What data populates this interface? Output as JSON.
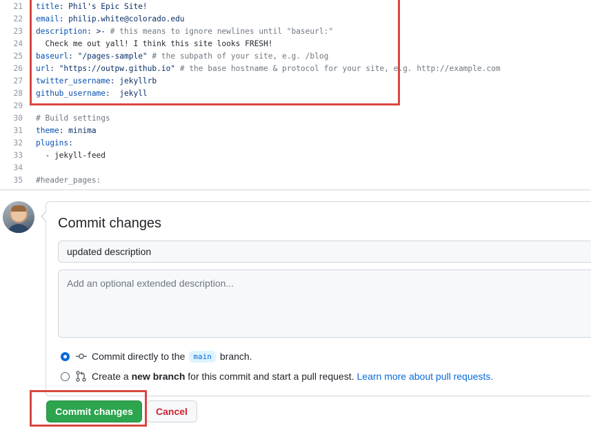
{
  "code_lines": [
    {
      "num": "21",
      "key": "title",
      "rest": ": Phil's Epic Site!"
    },
    {
      "num": "22",
      "key": "email",
      "rest": ": philip.white@colorado.edu"
    },
    {
      "num": "23",
      "key": "description",
      "rest": ": >- ",
      "comment": "# this means to ignore newlines until \"baseurl:\""
    },
    {
      "num": "24",
      "plain": "  Check me out yall! I think this site looks FRESH!"
    },
    {
      "num": "25",
      "key": "baseurl",
      "rest": ": \"/pages-sample\" ",
      "comment": "# the subpath of your site, e.g. /blog"
    },
    {
      "num": "26",
      "key": "url",
      "rest": ": \"https://outpw.github.io\" ",
      "comment": "# the base hostname & protocol for your site, e.g. http://example.com"
    },
    {
      "num": "27",
      "key": "twitter_username",
      "rest": ": jekyllrb"
    },
    {
      "num": "28",
      "key": "github_username",
      "rest": ":  jekyll"
    },
    {
      "num": "29",
      "plain": ""
    },
    {
      "num": "30",
      "comment_only": "# Build settings"
    },
    {
      "num": "31",
      "key": "theme",
      "rest": ": minima"
    },
    {
      "num": "32",
      "key": "plugins",
      "rest": ":"
    },
    {
      "num": "33",
      "plain": "  - jekyll-feed"
    },
    {
      "num": "34",
      "plain": ""
    },
    {
      "num": "35",
      "comment_only": "#header_pages:"
    }
  ],
  "commit": {
    "title": "Commit changes",
    "summary_value": "updated description",
    "description_placeholder": "Add an optional extended description...",
    "option_direct_prefix": "Commit directly to the",
    "branch_name": "main",
    "option_direct_suffix": "branch.",
    "option_new_prefix": "Create a",
    "option_new_bold": "new branch",
    "option_new_suffix": "for this commit and start a pull request.",
    "learn_more_link": "Learn more about pull requests.",
    "selected_option": "direct"
  },
  "buttons": {
    "commit_label": "Commit changes",
    "cancel_label": "Cancel"
  },
  "colors": {
    "highlight": "#d9463f",
    "primary": "#2da44e",
    "danger": "#cf222e",
    "link": "#0969da"
  }
}
